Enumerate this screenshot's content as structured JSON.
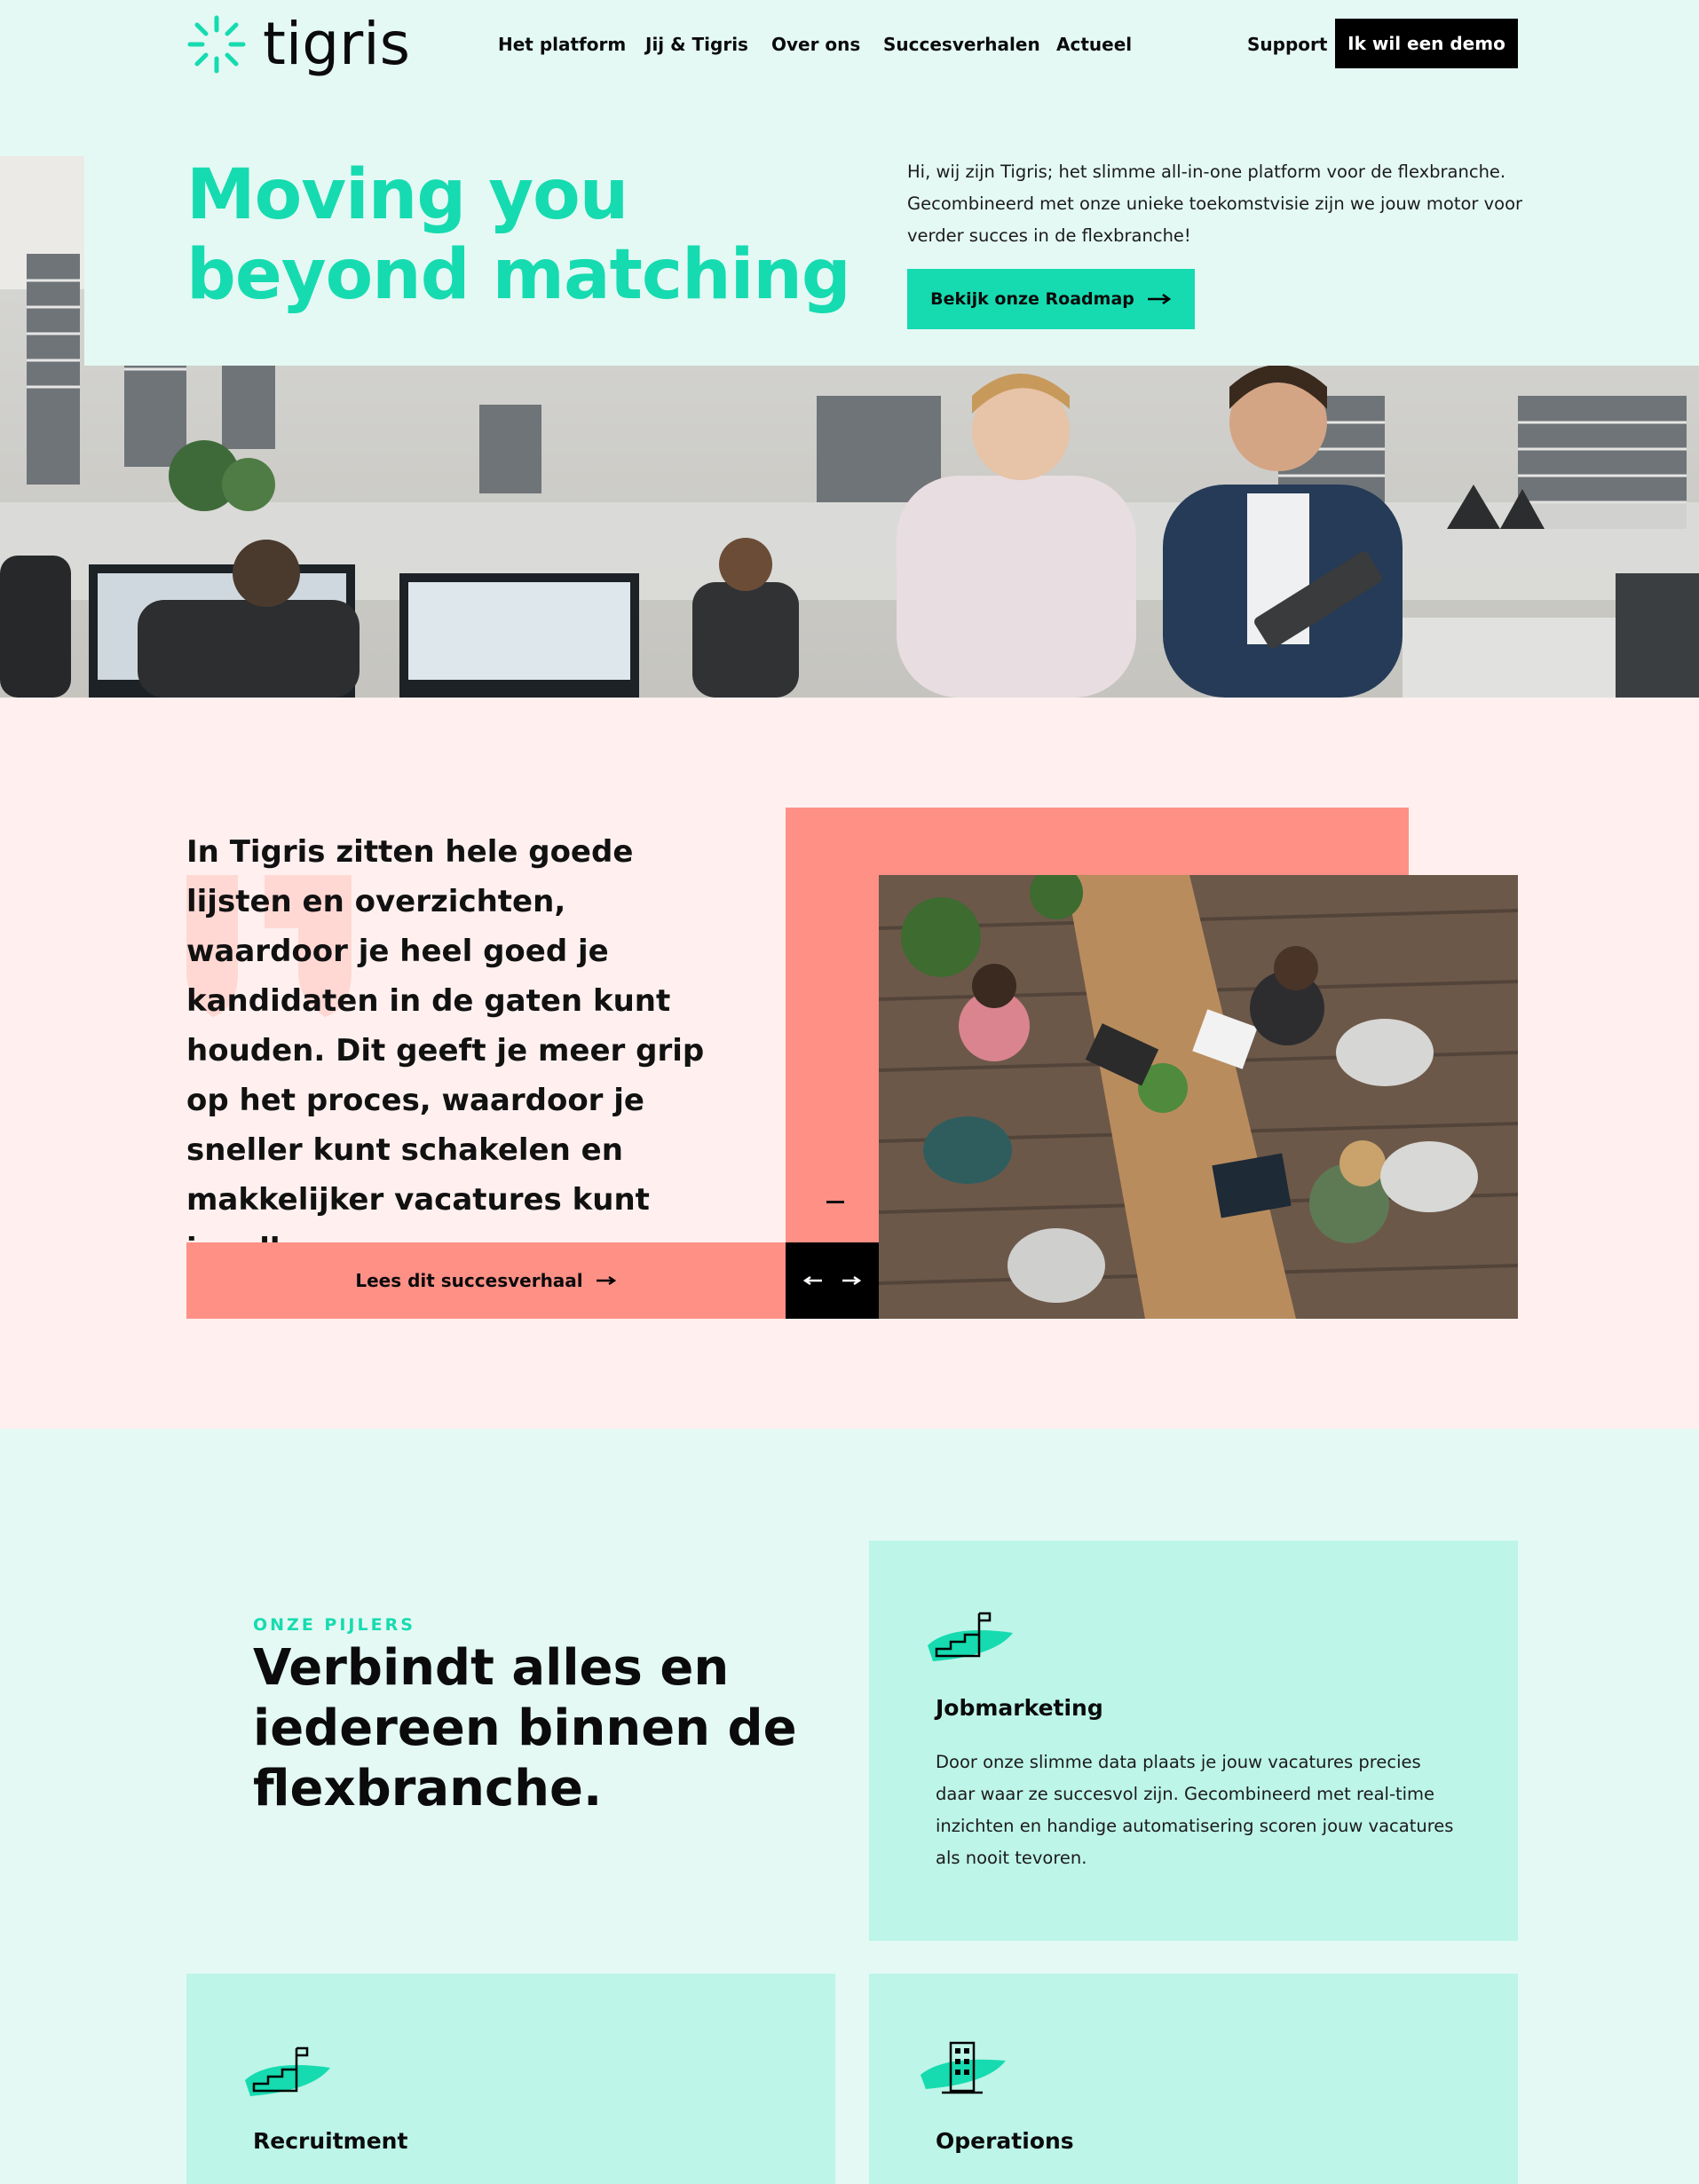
{
  "brand": {
    "name": "tigris",
    "accent": "#16dbb0",
    "salmon": "#ff9086"
  },
  "nav": {
    "items": [
      "Het platform",
      "Jij & Tigris",
      "Over ons",
      "Succesverhalen",
      "Actueel"
    ],
    "support": "Support",
    "demo": "Ik wil een demo"
  },
  "hero": {
    "title_line1": "Moving you",
    "title_line2": "beyond matching",
    "text": "Hi, wij zijn Tigris; het slimme all-in-one platform voor de flexbranche. Gecombineerd met onze unieke toekomstvisie zijn we jouw motor voor verder succes in de flexbranche!",
    "cta": "Bekijk onze Roadmap"
  },
  "quote": {
    "text": "In Tigris zitten hele goede lijsten en overzichten, waardoor je heel goed je kandidaten in de gaten kunt houden. Dit geeft je meer grip op het proces, waardoor je sneller kunt schakelen en makkelijker vacatures kunt invullen.",
    "cta": "Lees dit succesverhaal"
  },
  "pillars": {
    "label": "ONZE PIJLERS",
    "title": "Verbindt alles en iedereen binnen de flexbranche.",
    "cards": [
      {
        "title": "Jobmarketing",
        "icon": "stairs-flag-icon",
        "text": "Door onze slimme data plaats je jouw vacatures precies daar waar ze succesvol zijn. Gecombineerd met real-time inzichten en handige automatisering scoren jouw vacatures als nooit tevoren."
      },
      {
        "title": "Recruitment",
        "icon": "stairs-flag-icon",
        "text": ""
      },
      {
        "title": "Operations",
        "icon": "building-icon",
        "text": ""
      }
    ]
  }
}
